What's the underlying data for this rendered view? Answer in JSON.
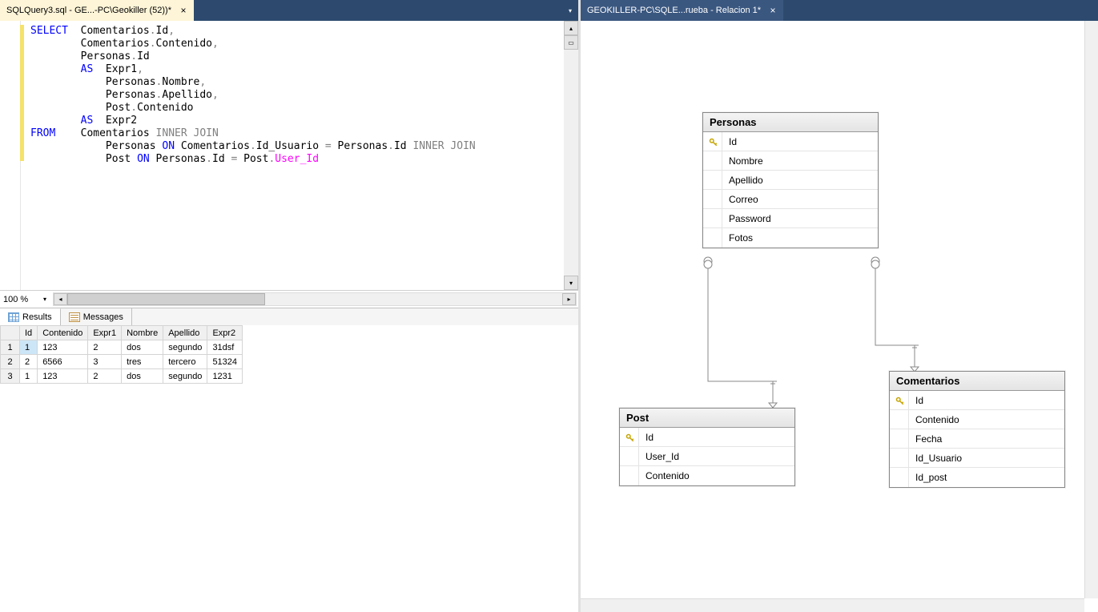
{
  "left": {
    "tab": {
      "label": "SQLQuery3.sql - GE...-PC\\Geokiller (52))*"
    },
    "sql": {
      "lines": [
        [
          {
            "t": "SELECT",
            "c": "kw"
          },
          {
            "t": "  Comentarios"
          },
          {
            "t": ".",
            "c": "gray"
          },
          {
            "t": "Id"
          },
          {
            "t": ",",
            "c": "gray"
          }
        ],
        [
          {
            "t": "        Comentarios"
          },
          {
            "t": ".",
            "c": "gray"
          },
          {
            "t": "Contenido"
          },
          {
            "t": ",",
            "c": "gray"
          }
        ],
        [
          {
            "t": "        Personas"
          },
          {
            "t": ".",
            "c": "gray"
          },
          {
            "t": "Id"
          }
        ],
        [
          {
            "t": "        "
          },
          {
            "t": "AS",
            "c": "kw"
          },
          {
            "t": "  Expr1"
          },
          {
            "t": ",",
            "c": "gray"
          }
        ],
        [
          {
            "t": "            Personas"
          },
          {
            "t": ".",
            "c": "gray"
          },
          {
            "t": "Nombre"
          },
          {
            "t": ",",
            "c": "gray"
          }
        ],
        [
          {
            "t": "            Personas"
          },
          {
            "t": ".",
            "c": "gray"
          },
          {
            "t": "Apellido"
          },
          {
            "t": ",",
            "c": "gray"
          }
        ],
        [
          {
            "t": "            Post"
          },
          {
            "t": ".",
            "c": "gray"
          },
          {
            "t": "Contenido"
          }
        ],
        [
          {
            "t": "        "
          },
          {
            "t": "AS",
            "c": "kw"
          },
          {
            "t": "  Expr2"
          }
        ],
        [
          {
            "t": "FROM",
            "c": "kw"
          },
          {
            "t": "    Comentarios "
          },
          {
            "t": "INNER JOIN",
            "c": "gray"
          }
        ],
        [
          {
            "t": "            Personas "
          },
          {
            "t": "ON",
            "c": "kw"
          },
          {
            "t": " Comentarios"
          },
          {
            "t": ".",
            "c": "gray"
          },
          {
            "t": "Id_Usuario "
          },
          {
            "t": "=",
            "c": "gray"
          },
          {
            "t": " Personas"
          },
          {
            "t": ".",
            "c": "gray"
          },
          {
            "t": "Id "
          },
          {
            "t": "INNER JOIN",
            "c": "gray"
          }
        ],
        [
          {
            "t": "            Post "
          },
          {
            "t": "ON",
            "c": "kw"
          },
          {
            "t": " Personas"
          },
          {
            "t": ".",
            "c": "gray"
          },
          {
            "t": "Id "
          },
          {
            "t": "=",
            "c": "gray"
          },
          {
            "t": " Post"
          },
          {
            "t": ".",
            "c": "gray"
          },
          {
            "t": "User_Id",
            "c": "mag"
          }
        ]
      ]
    },
    "zoom": "100 %",
    "resultsTab": "Results",
    "messagesTab": "Messages",
    "grid": {
      "headers": [
        "",
        "Id",
        "Contenido",
        "Expr1",
        "Nombre",
        "Apellido",
        "Expr2"
      ],
      "rows": [
        [
          "1",
          "1",
          "123",
          "2",
          "dos",
          "segundo",
          "31dsf"
        ],
        [
          "2",
          "2",
          "6566",
          "3",
          "tres",
          "tercero",
          "51324"
        ],
        [
          "3",
          "1",
          "123",
          "2",
          "dos",
          "segundo",
          "1231"
        ]
      ]
    }
  },
  "right": {
    "tab": {
      "label": "GEOKILLER-PC\\SQLE...rueba - Relacion 1*"
    },
    "tables": {
      "personas": {
        "title": "Personas",
        "cols": [
          {
            "name": "Id",
            "pk": true
          },
          {
            "name": "Nombre",
            "pk": false
          },
          {
            "name": "Apellido",
            "pk": false
          },
          {
            "name": "Correo",
            "pk": false
          },
          {
            "name": "Password",
            "pk": false
          },
          {
            "name": "Fotos",
            "pk": false
          }
        ]
      },
      "post": {
        "title": "Post",
        "cols": [
          {
            "name": "Id",
            "pk": true
          },
          {
            "name": "User_Id",
            "pk": false
          },
          {
            "name": "Contenido",
            "pk": false
          }
        ]
      },
      "comentarios": {
        "title": "Comentarios",
        "cols": [
          {
            "name": "Id",
            "pk": true
          },
          {
            "name": "Contenido",
            "pk": false
          },
          {
            "name": "Fecha",
            "pk": false
          },
          {
            "name": "Id_Usuario",
            "pk": false
          },
          {
            "name": "Id_post",
            "pk": false
          }
        ]
      }
    }
  }
}
